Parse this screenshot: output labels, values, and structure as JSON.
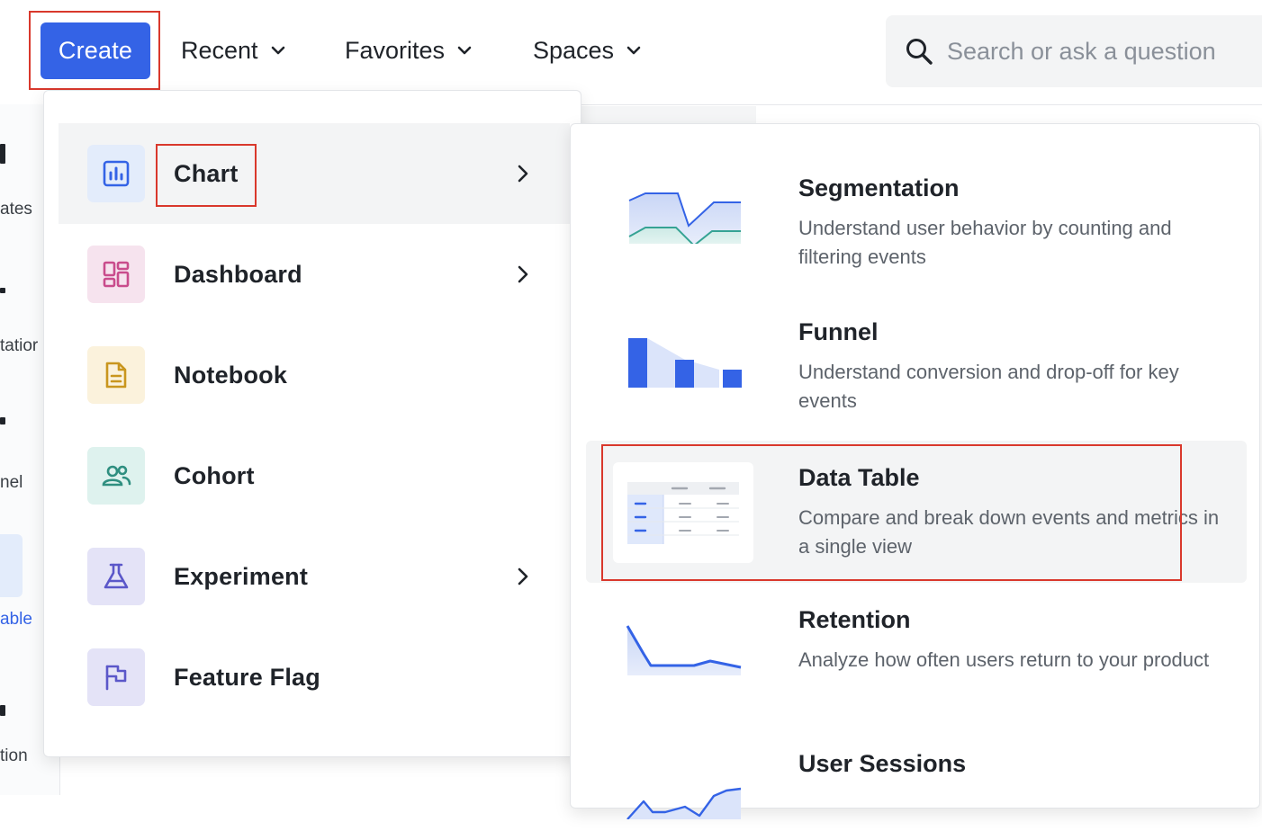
{
  "topbar": {
    "create_label": "Create",
    "nav": [
      {
        "label": "Recent"
      },
      {
        "label": "Favorites"
      },
      {
        "label": "Spaces"
      }
    ],
    "search_placeholder": "Search or ask a question"
  },
  "background_sidebar": {
    "items": [
      "ates",
      "tatior",
      "nel",
      "able",
      "tion"
    ]
  },
  "create_menu": {
    "items": [
      {
        "label": "Chart",
        "icon": "bar-chart-icon",
        "has_submenu": true,
        "active": true
      },
      {
        "label": "Dashboard",
        "icon": "dashboard-icon",
        "has_submenu": true
      },
      {
        "label": "Notebook",
        "icon": "notebook-icon",
        "has_submenu": false
      },
      {
        "label": "Cohort",
        "icon": "users-icon",
        "has_submenu": false
      },
      {
        "label": "Experiment",
        "icon": "flask-icon",
        "has_submenu": true
      },
      {
        "label": "Feature Flag",
        "icon": "flag-icon",
        "has_submenu": false
      }
    ]
  },
  "chart_submenu": {
    "items": [
      {
        "title": "Segmentation",
        "desc": "Understand user behavior by counting and filtering events"
      },
      {
        "title": "Funnel",
        "desc": "Understand conversion and drop-off for key events"
      },
      {
        "title": "Data Table",
        "desc": "Compare and break down events and metrics in a single view",
        "active": true
      },
      {
        "title": "Retention",
        "desc": "Analyze how often users return to your product"
      },
      {
        "title": "User Sessions",
        "desc": ""
      }
    ]
  },
  "colors": {
    "accent": "#3463e6",
    "highlight_border": "#d9382c",
    "chart_icon_bg": "#e3ecfb",
    "dashboard_icon_bg": "#f6e3ee",
    "notebook_icon_bg": "#fbf2dc",
    "cohort_icon_bg": "#def2ee",
    "experiment_icon_bg": "#e4e3f7",
    "flag_icon_bg": "#e4e3f7"
  }
}
